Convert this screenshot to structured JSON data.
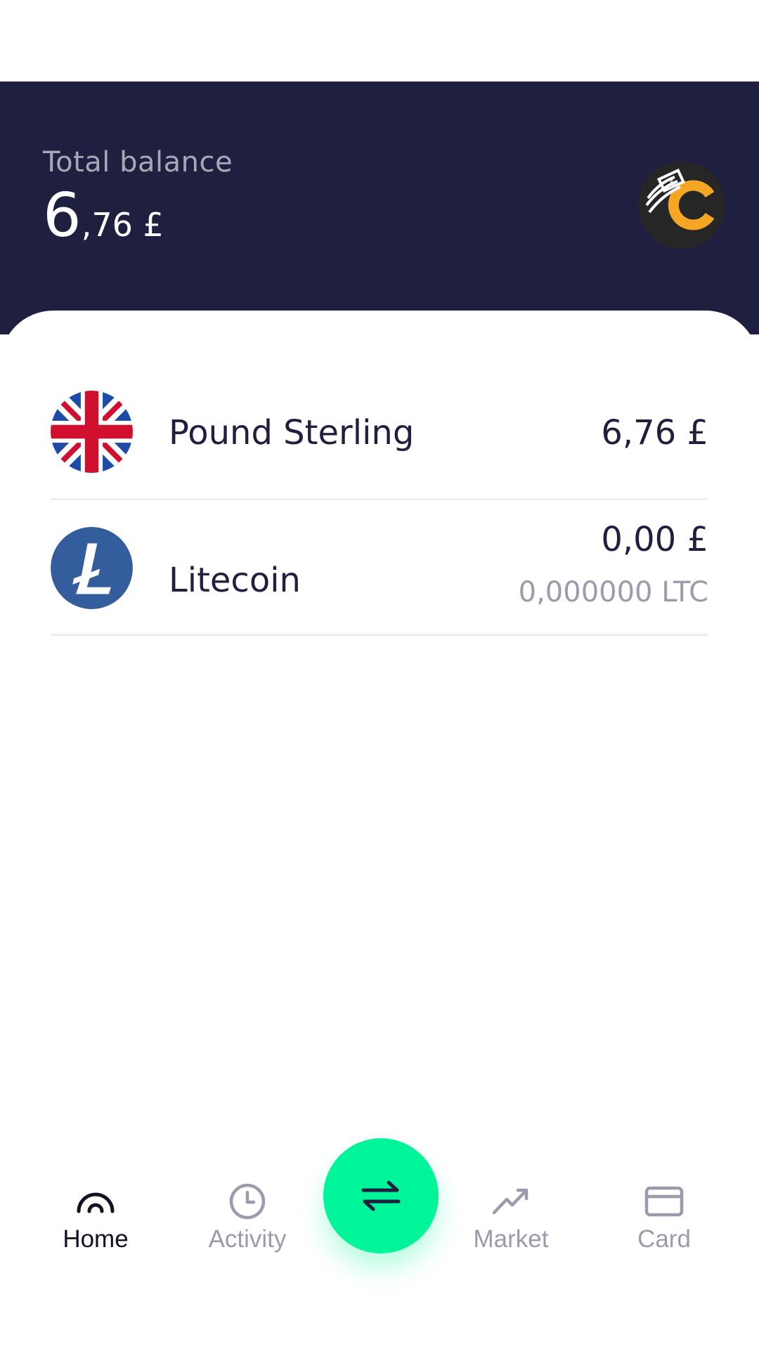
{
  "header": {
    "balance_label": "Total balance",
    "balance_integer": "6",
    "balance_decimal": ",76 £",
    "background_color": "#1f2040"
  },
  "assets": [
    {
      "name": "Pound Sterling",
      "amount": "6,76 £",
      "sub_amount": "",
      "icon": "uk-flag-icon"
    },
    {
      "name": "Litecoin",
      "amount": "0,00 £",
      "sub_amount": "0,000000 LTC",
      "icon": "litecoin-icon"
    }
  ],
  "nav": {
    "home": {
      "label": "Home",
      "icon": "home-icon",
      "active": true
    },
    "activity": {
      "label": "Activity",
      "icon": "clock-icon",
      "active": false
    },
    "exchange": {
      "icon": "swap-arrows-icon",
      "color": "#00f598"
    },
    "market": {
      "label": "Market",
      "icon": "trend-up-icon",
      "active": false
    },
    "card": {
      "label": "Card",
      "icon": "card-icon",
      "active": false
    }
  },
  "colors": {
    "primary_text": "#1f2040",
    "muted_text": "#9a9cab",
    "accent": "#00f598",
    "divider": "#eceef1"
  }
}
